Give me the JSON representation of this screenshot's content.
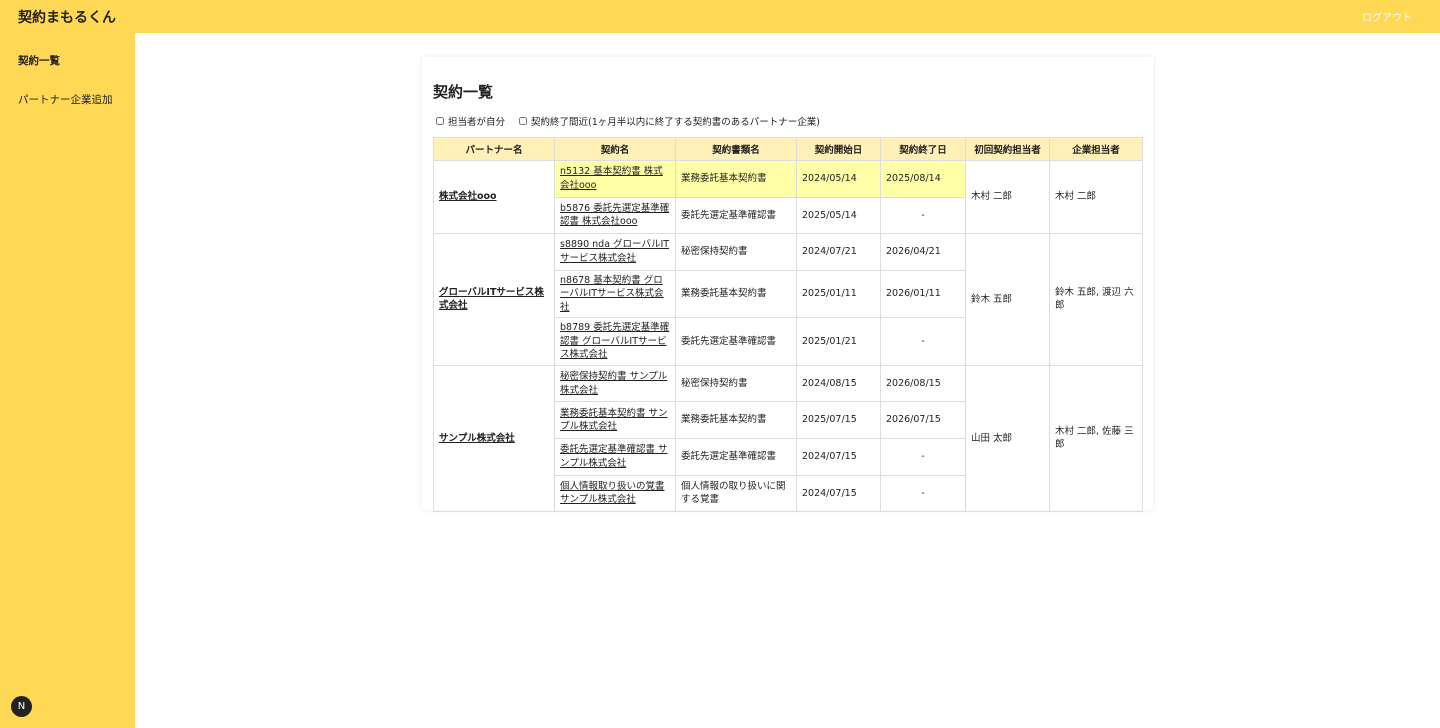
{
  "header": {
    "title": "契約まもるくん",
    "logout": "ログアウト"
  },
  "sidebar": {
    "items": [
      {
        "label": "契約一覧"
      },
      {
        "label": "パートナー企業追加"
      }
    ],
    "badge": "N"
  },
  "main": {
    "title": "契約一覧",
    "filters": [
      {
        "label": "担当者が自分",
        "checked": false
      },
      {
        "label": "契約終了間近(1ヶ月半以内に終了する契約書のあるパートナー企業)",
        "checked": false
      }
    ],
    "columns": [
      "パートナー名",
      "契約名",
      "契約書類名",
      "契約開始日",
      "契約終了日",
      "初回契約担当者",
      "企業担当者"
    ],
    "partners": [
      {
        "name": "株式会社ooo",
        "first_rep": "木村 二郎",
        "company_rep": "木村 二郎",
        "contracts": [
          {
            "name": "n5132 基本契約書 株式会社ooo",
            "doc": "業務委託基本契約書",
            "start": "2024/05/14",
            "end": "2025/08/14",
            "highlight": true
          },
          {
            "name": "b5876 委託先選定基準確認書 株式会社ooo",
            "doc": "委託先選定基準確認書",
            "start": "2025/05/14",
            "end": "-"
          }
        ]
      },
      {
        "name": "グローバルITサービス株式会社",
        "first_rep": "鈴木 五郎",
        "company_rep": "鈴木 五郎, 渡辺 六郎",
        "contracts": [
          {
            "name": "s8890 nda グローバルITサービス株式会社",
            "doc": "秘密保持契約書",
            "start": "2024/07/21",
            "end": "2026/04/21"
          },
          {
            "name": "n8678 基本契約書 グローバルITサービス株式会社",
            "doc": "業務委託基本契約書",
            "start": "2025/01/11",
            "end": "2026/01/11"
          },
          {
            "name": "b8789 委託先選定基準確認書 グローバルITサービス株式会社",
            "doc": "委託先選定基準確認書",
            "start": "2025/01/21",
            "end": "-"
          }
        ]
      },
      {
        "name": "サンプル株式会社",
        "first_rep": "山田 太郎",
        "company_rep": "木村 二郎, 佐藤 三郎",
        "contracts": [
          {
            "name": "秘密保持契約書 サンプル株式会社",
            "doc": "秘密保持契約書",
            "start": "2024/08/15",
            "end": "2026/08/15"
          },
          {
            "name": "業務委託基本契約書 サンプル株式会社",
            "doc": "業務委託基本契約書",
            "start": "2025/07/15",
            "end": "2026/07/15"
          },
          {
            "name": "委託先選定基準確認書 サンプル株式会社",
            "doc": "委託先選定基準確認書",
            "start": "2024/07/15",
            "end": "-"
          },
          {
            "name": "個人情報取り扱いの覚書 サンプル株式会社",
            "doc": "個人情報の取り扱いに関する覚書",
            "start": "2024/07/15",
            "end": "-"
          }
        ]
      }
    ]
  }
}
